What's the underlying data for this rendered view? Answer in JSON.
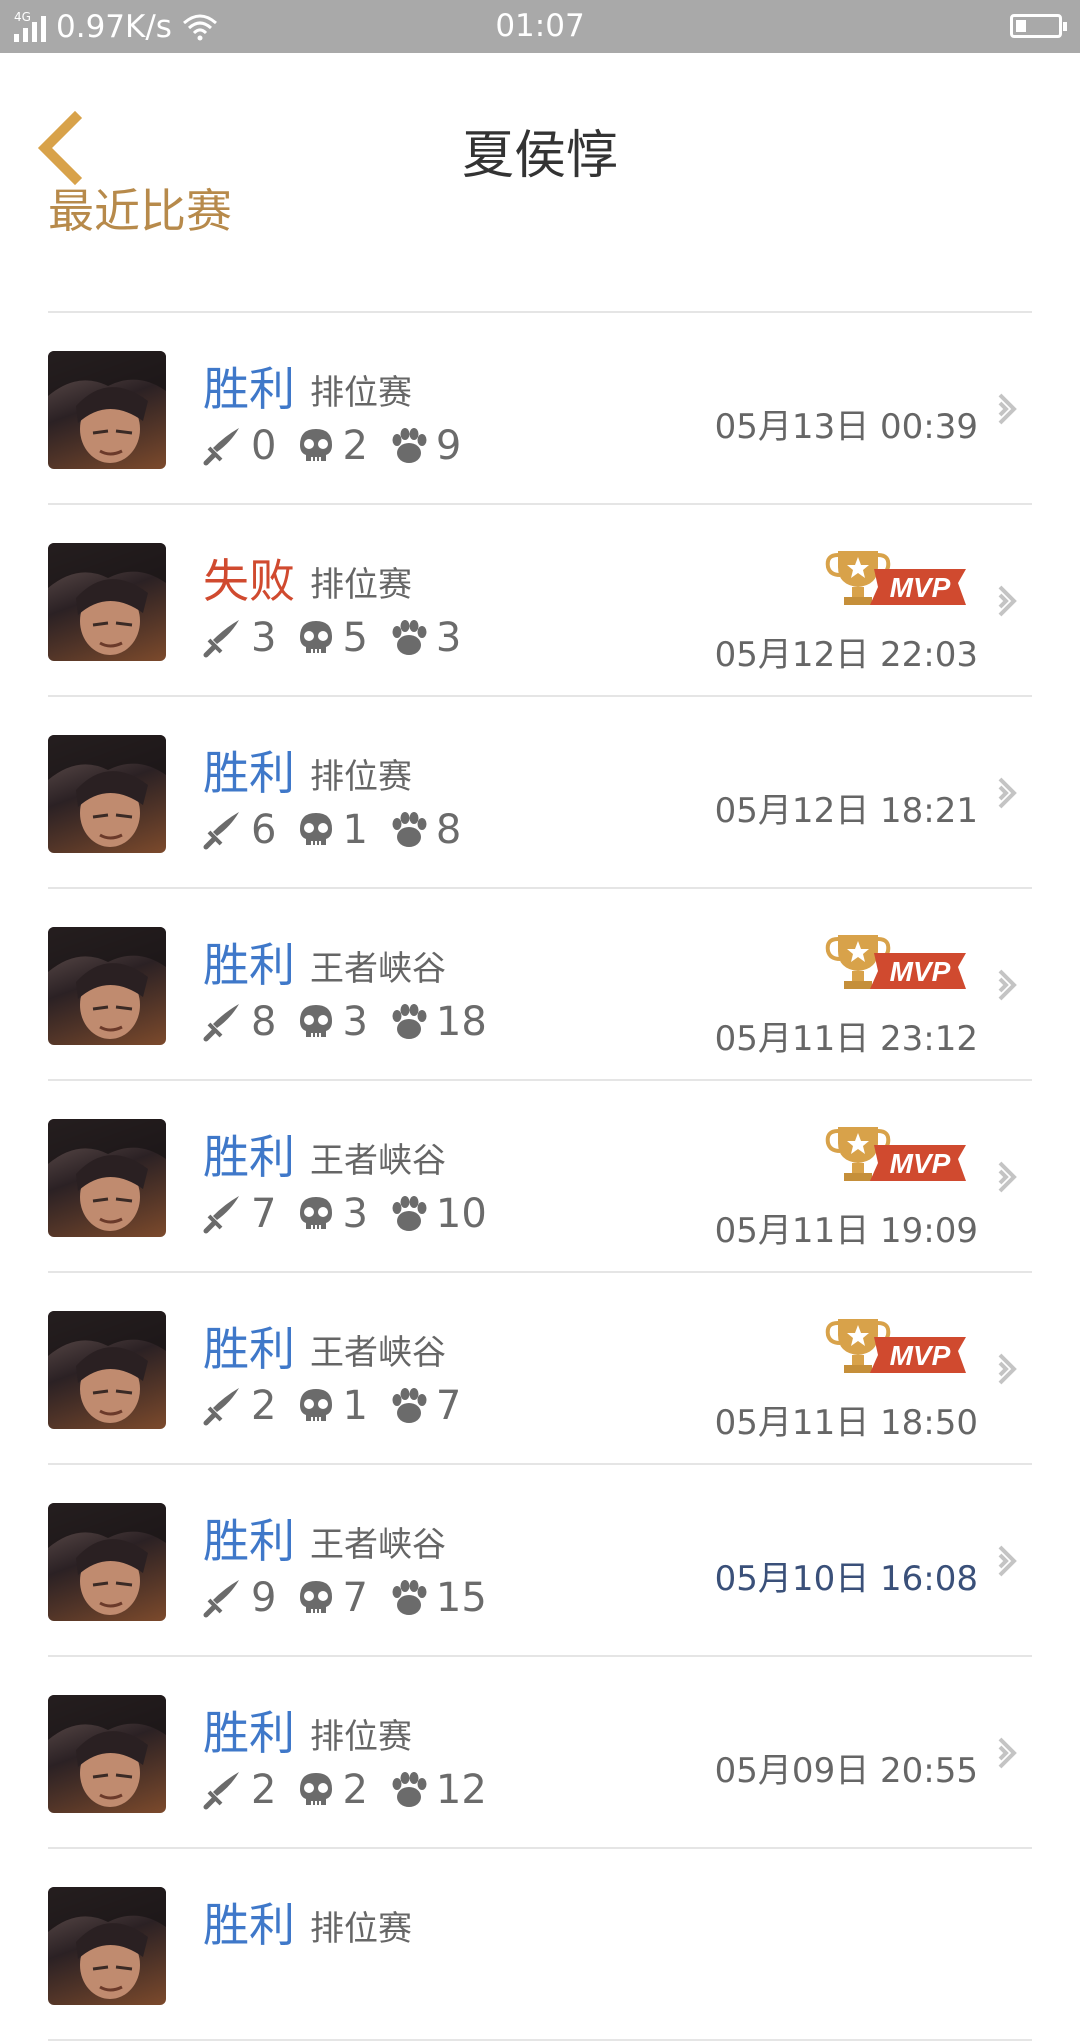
{
  "status_bar": {
    "network": "4G",
    "speed": "0.97K/s",
    "time": "01:07"
  },
  "header": {
    "title": "夏侯惇"
  },
  "section": {
    "title": "最近比赛"
  },
  "colors": {
    "win": "#3f78c9",
    "lose": "#d04a2f",
    "section_title": "#b78a4b",
    "mvp_gold": "#d8a24a",
    "mvp_red": "#d04a2f"
  },
  "matches": [
    {
      "result": "胜利",
      "mode": "排位赛",
      "kills": "0",
      "deaths": "2",
      "assists": "9",
      "date": "05月13日 00:39",
      "mvp": false,
      "highlight": false
    },
    {
      "result": "失败",
      "mode": "排位赛",
      "kills": "3",
      "deaths": "5",
      "assists": "3",
      "date": "05月12日 22:03",
      "mvp": true,
      "highlight": false
    },
    {
      "result": "胜利",
      "mode": "排位赛",
      "kills": "6",
      "deaths": "1",
      "assists": "8",
      "date": "05月12日 18:21",
      "mvp": false,
      "highlight": false
    },
    {
      "result": "胜利",
      "mode": "王者峡谷",
      "kills": "8",
      "deaths": "3",
      "assists": "18",
      "date": "05月11日 23:12",
      "mvp": true,
      "highlight": false
    },
    {
      "result": "胜利",
      "mode": "王者峡谷",
      "kills": "7",
      "deaths": "3",
      "assists": "10",
      "date": "05月11日 19:09",
      "mvp": true,
      "highlight": false
    },
    {
      "result": "胜利",
      "mode": "王者峡谷",
      "kills": "2",
      "deaths": "1",
      "assists": "7",
      "date": "05月11日 18:50",
      "mvp": true,
      "highlight": false
    },
    {
      "result": "胜利",
      "mode": "王者峡谷",
      "kills": "9",
      "deaths": "7",
      "assists": "15",
      "date": "05月10日 16:08",
      "mvp": false,
      "highlight": true
    },
    {
      "result": "胜利",
      "mode": "排位赛",
      "kills": "2",
      "deaths": "2",
      "assists": "12",
      "date": "05月09日 20:55",
      "mvp": false,
      "highlight": false
    },
    {
      "result": "胜利",
      "mode": "排位赛",
      "kills": "",
      "deaths": "",
      "assists": "",
      "date": "",
      "mvp": false,
      "highlight": false
    }
  ],
  "icons": {
    "back": "back-chevron-icon",
    "kills": "sword-icon",
    "deaths": "skull-icon",
    "assists": "paw-icon",
    "mvp": "mvp-trophy-badge",
    "row_arrow": "chevron-right-icon"
  }
}
